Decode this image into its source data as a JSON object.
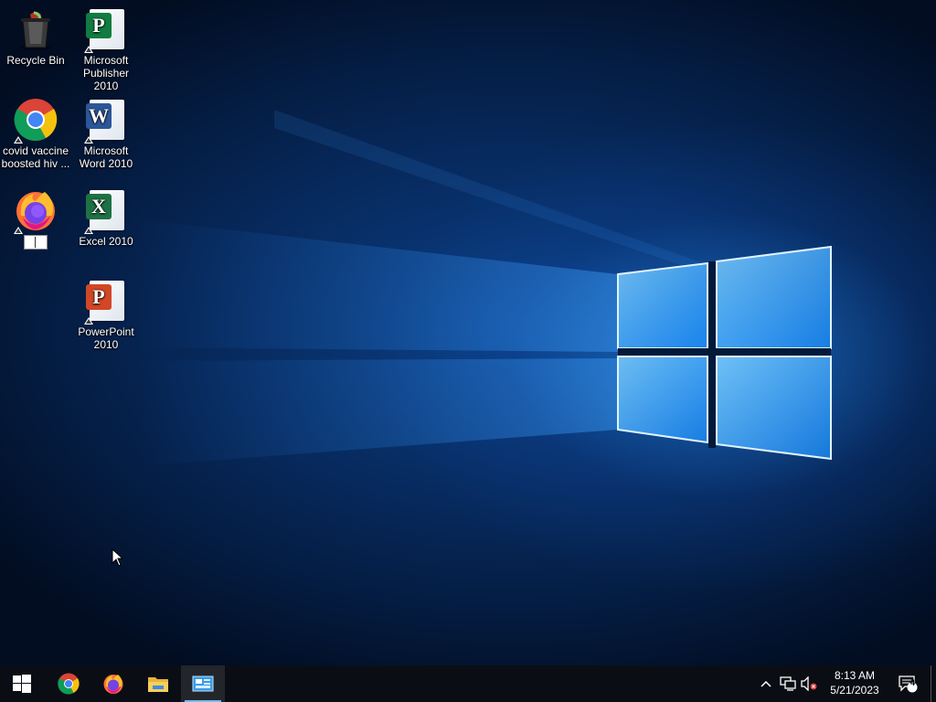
{
  "desktop": {
    "icons": [
      {
        "label": "Recycle Bin"
      },
      {
        "label": "Microsoft Publisher 2010"
      },
      {
        "label": "covid vaccine boosted hiv ..."
      },
      {
        "label": "Microsoft Word 2010"
      },
      {
        "label": "Excel 2010"
      },
      {
        "label": "PowerPoint 2010"
      }
    ]
  },
  "icons": {
    "recycle": "recycle-bin-icon",
    "publisher": "publisher-icon",
    "chrome": "chrome-icon",
    "word": "word-icon",
    "firefox": "firefox-icon",
    "excel": "excel-icon",
    "powerpoint": "powerpoint-icon"
  },
  "office_letters": {
    "publisher": "P",
    "word": "W",
    "excel": "X",
    "powerpoint": "P"
  },
  "taskbar": {
    "pinned": [
      "start-button",
      "chrome",
      "firefox",
      "file-explorer",
      "remote-desktop"
    ],
    "clock": {
      "time": "8:13 AM",
      "date": "5/21/2023"
    },
    "notification_count": "4"
  },
  "colors": {
    "taskbar": "#0a0e14",
    "active_indicator": "#76b9ed",
    "publisher": "#107c41",
    "word": "#2b579a",
    "excel": "#1e7145",
    "powerpoint": "#d24726"
  }
}
